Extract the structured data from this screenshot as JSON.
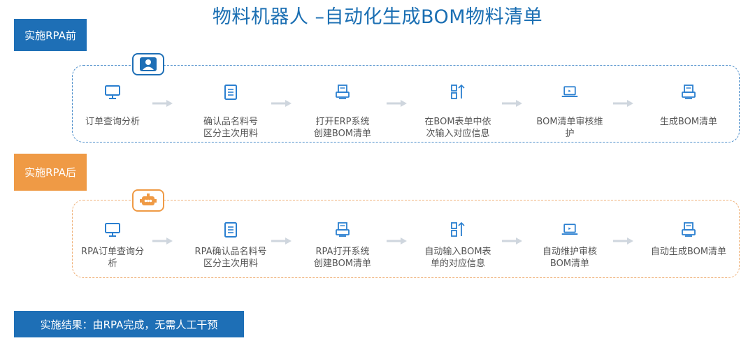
{
  "title": "物料机器人 –自动化生成BOM物料清单",
  "tags": {
    "before": "实施RPA前",
    "after": "实施RPA后",
    "result": "实施结果：由RPA完成，无需人工干预"
  },
  "before_steps": [
    {
      "icon": "monitor-icon",
      "line1": "订单查询分析",
      "line2": ""
    },
    {
      "icon": "list-icon",
      "line1": "确认品名料号",
      "line2": "区分主次用料"
    },
    {
      "icon": "printer-icon",
      "line1": "打开ERP系统",
      "line2": "创建BOM清单"
    },
    {
      "icon": "input-icon",
      "line1": "在BOM表单中依",
      "line2": "次输入对应信息"
    },
    {
      "icon": "laptop-icon",
      "line1": "BOM清单审核维",
      "line2": "护"
    },
    {
      "icon": "printer-icon",
      "line1": "生成BOM清单",
      "line2": ""
    }
  ],
  "after_steps": [
    {
      "icon": "monitor-icon",
      "line1": "RPA订单查询分",
      "line2": "析"
    },
    {
      "icon": "list-icon",
      "line1": "RPA确认品名料号",
      "line2": "区分主次用料"
    },
    {
      "icon": "printer-icon",
      "line1": "RPA打开系统",
      "line2": "创建BOM清单"
    },
    {
      "icon": "input-icon",
      "line1": "自动输入BOM表",
      "line2": "单的对应信息"
    },
    {
      "icon": "laptop-icon",
      "line1": "自动维护审核",
      "line2": "BOM清单"
    },
    {
      "icon": "printer-icon",
      "line1": "自动生成BOM清单",
      "line2": ""
    }
  ],
  "colors": {
    "blue": "#1e6fb6",
    "orange": "#ef9a45",
    "icon_blue": "#2a7fd0",
    "arrow_gray": "#cfd6de"
  }
}
